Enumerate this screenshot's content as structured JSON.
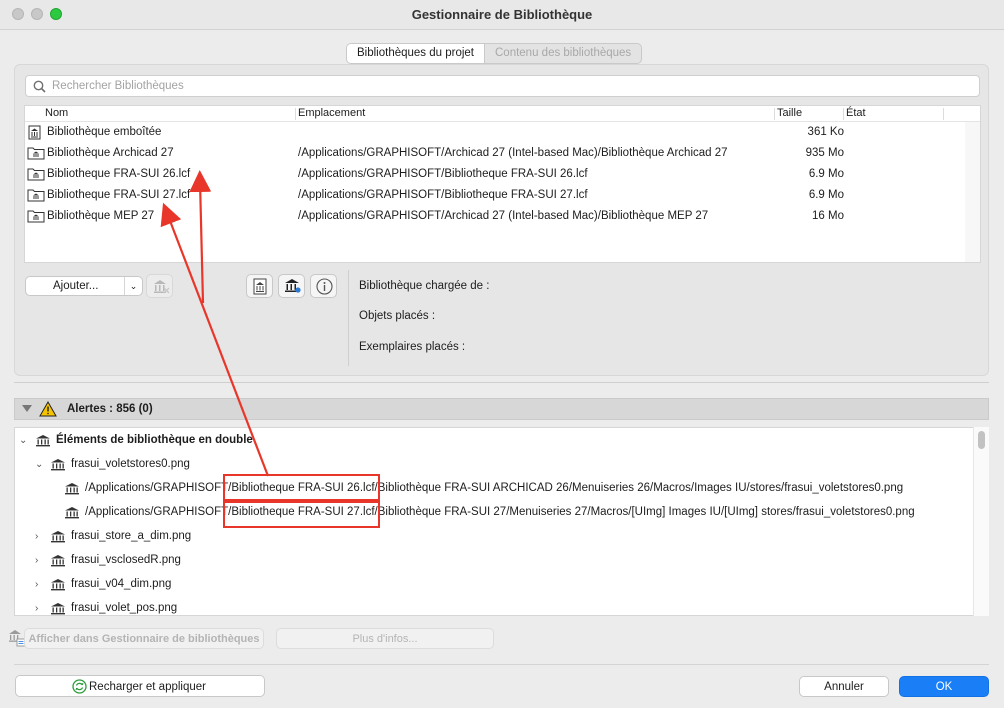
{
  "window": {
    "title": "Gestionnaire de Bibliothèque"
  },
  "tabs": [
    {
      "label": "Bibliothèques du projet",
      "active": true
    },
    {
      "label": "Contenu des bibliothèques",
      "active": false
    }
  ],
  "search": {
    "placeholder": "Rechercher Bibliothèques"
  },
  "table": {
    "columns": [
      "Nom",
      "Emplacement",
      "Taille",
      "État"
    ],
    "rows": [
      {
        "name": "Bibliothèque emboîtée",
        "location": "",
        "size": "361 Ko",
        "icon": "embedded-library-icon"
      },
      {
        "name": "Bibliothèque Archicad 27",
        "location": "/Applications/GRAPHISOFT/Archicad 27 (Intel-based Mac)/Bibliothèque Archicad 27",
        "size": "935 Mo",
        "icon": "folder-library-icon"
      },
      {
        "name": "Bibliotheque FRA-SUI 26.lcf",
        "location": "/Applications/GRAPHISOFT/Bibliotheque FRA-SUI 26.lcf",
        "size": "6.9 Mo",
        "icon": "folder-library-icon"
      },
      {
        "name": "Bibliotheque FRA-SUI 27.lcf",
        "location": "/Applications/GRAPHISOFT/Bibliotheque FRA-SUI 27.lcf",
        "size": "6.9 Mo",
        "icon": "folder-library-icon"
      },
      {
        "name": "Bibliothèque MEP 27",
        "location": "/Applications/GRAPHISOFT/Archicad 27 (Intel-based Mac)/Bibliothèque MEP 27",
        "size": "16 Mo",
        "icon": "folder-library-icon"
      }
    ]
  },
  "buttons": {
    "add": "Ajouter...",
    "reload": "Recharger et appliquer",
    "cancel": "Annuler",
    "ok": "OK",
    "show_in_manager": "Afficher dans Gestionnaire de bibliothèques",
    "more_info": "Plus d'infos..."
  },
  "info": {
    "loaded_from": "Bibliothèque chargée de :",
    "placed_objects": "Objets placés :",
    "placed_instances": "Exemplaires placés :"
  },
  "alerts": {
    "label": "Alertes : 856 (0)",
    "tree": [
      {
        "text": "Éléments de bibliothèque en double",
        "level": 0,
        "expanded": true,
        "bold": true
      },
      {
        "text": "frasui_voletstores0.png",
        "level": 1,
        "expanded": true
      },
      {
        "text": "/Applications/GRAPHISOFT/Bibliotheque FRA-SUI 26.lcf/Bibliothèque FRA-SUI ARCHICAD 26/Menuiseries 26/Macros/Images IU/stores/frasui_voletstores0.png",
        "level": 2
      },
      {
        "text": "/Applications/GRAPHISOFT/Bibliotheque FRA-SUI 27.lcf/Bibliothèque FRA-SUI 27/Menuiseries 27/Macros/[UImg] Images IU/[UImg] stores/frasui_voletstores0.png",
        "level": 2
      },
      {
        "text": "frasui_store_a_dim.png",
        "level": 1,
        "expanded": false
      },
      {
        "text": "frasui_vsclosedR.png",
        "level": 1,
        "expanded": false
      },
      {
        "text": "frasui_v04_dim.png",
        "level": 1,
        "expanded": false
      },
      {
        "text": "frasui_volet_pos.png",
        "level": 1,
        "expanded": false
      }
    ]
  },
  "colors": {
    "accent": "#1a7ff6",
    "annotation": "#e8372a",
    "warning": "#f5c400"
  }
}
